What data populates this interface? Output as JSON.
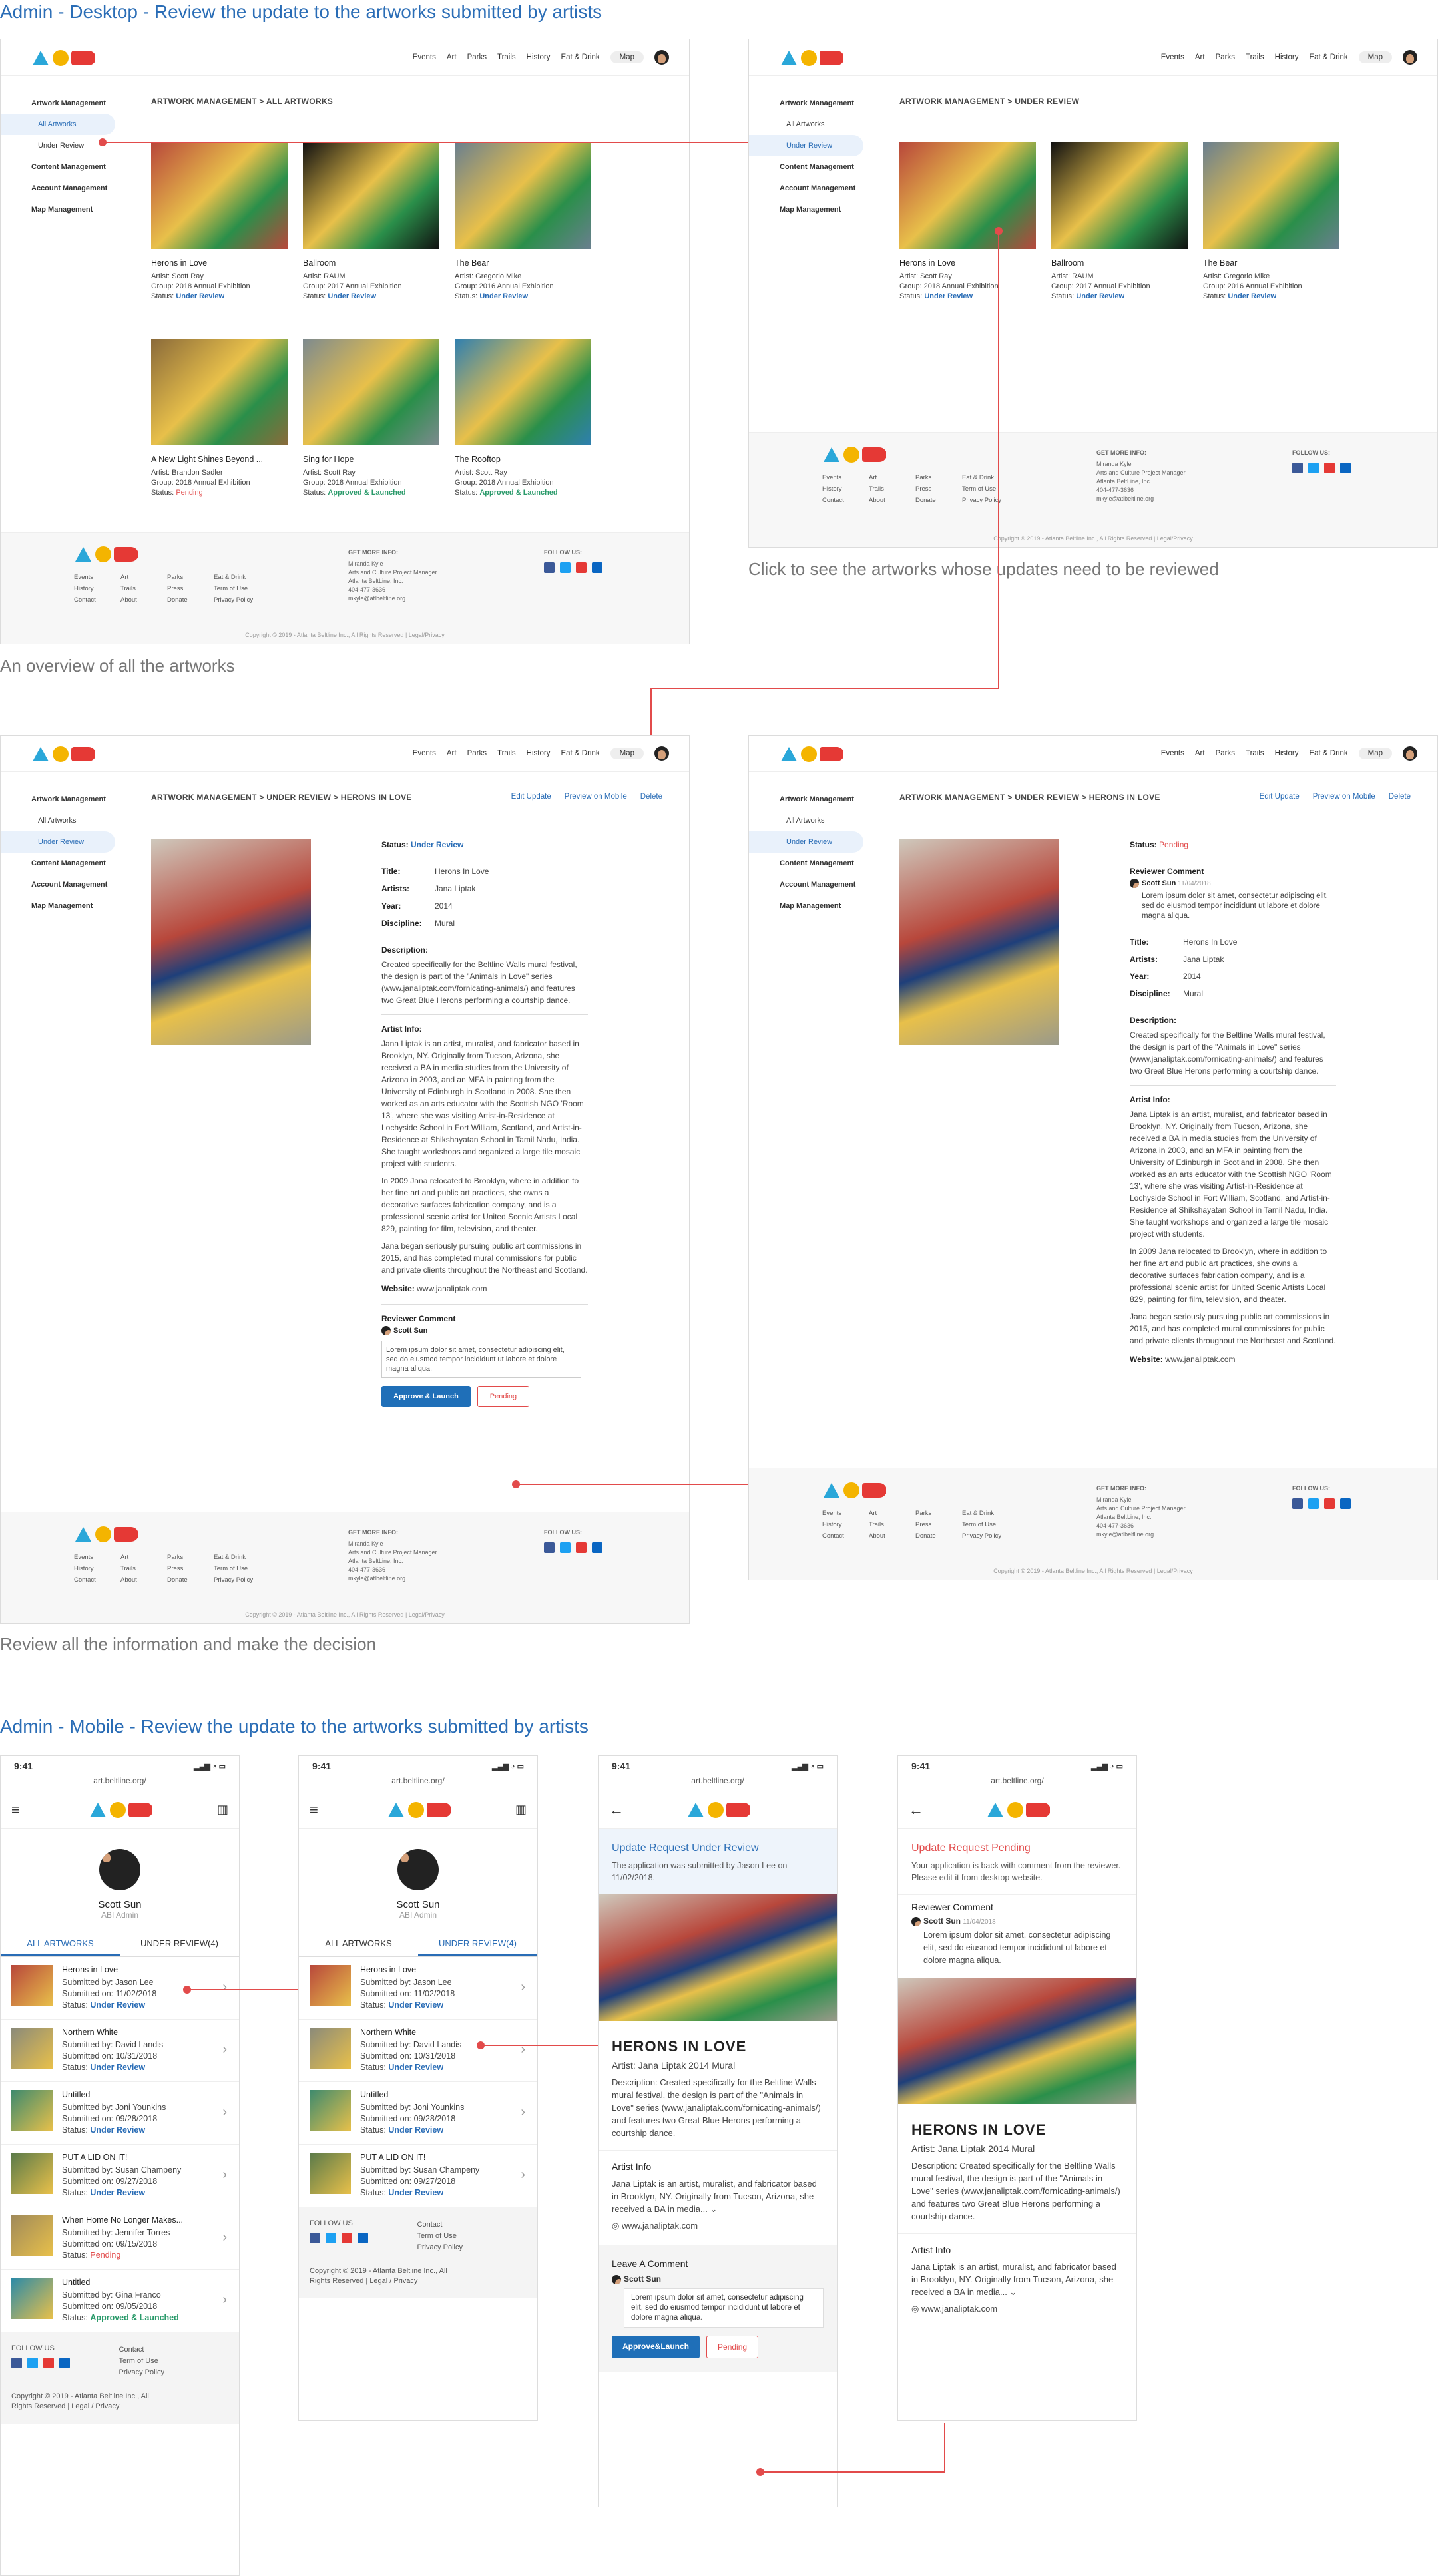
{
  "section1_title": "Admin - Desktop - Review the update to the artworks submitted by artists",
  "section2_title": "Admin - Mobile - Review the update to the artworks submitted by artists",
  "captions": {
    "overview": "An overview of all the artworks",
    "click": "Click to see the artworks whose updates need to be reviewed",
    "review": "Review all the information and make the decision"
  },
  "nav": {
    "links": [
      "Events",
      "Art",
      "Parks",
      "Trails",
      "History",
      "Eat & Drink"
    ],
    "map": "Map"
  },
  "sidebar": {
    "artwork_mgmt": "Artwork Management",
    "all": "All Artworks",
    "under_review": "Under Review",
    "content": "Content Management",
    "account": "Account Management",
    "map": "Map Management"
  },
  "crumbs": {
    "all": "ARTWORK MANAGEMENT  >  ALL ARTWORKS",
    "review": "ARTWORK MANAGEMENT  >  UNDER REVIEW",
    "detail": "ARTWORK MANAGEMENT  >  UNDER REVIEW  >  HERONS IN LOVE"
  },
  "actions": {
    "edit": "Edit Update",
    "preview": "Preview on Mobile",
    "delete": "Delete"
  },
  "artworks": [
    {
      "title": "Herons in Love",
      "artist": "Artist: Scott Ray",
      "group": "Group: 2018 Annual Exhibition",
      "status_label": "Status:",
      "status": "Under Review",
      "color": "#b8473b"
    },
    {
      "title": "Ballroom",
      "artist": "Artist: RAUM",
      "group": "Group: 2017 Annual Exhibition",
      "status_label": "Status:",
      "status": "Under Review",
      "color": "#111111"
    },
    {
      "title": "The Bear",
      "artist": "Artist: Gregorio Mike",
      "group": "Group: 2016 Annual Exhibition",
      "status_label": "Status:",
      "status": "Under Review",
      "color": "#6a7f8f"
    },
    {
      "title": "A New Light Shines Beyond ...",
      "artist": "Artist: Brandon Sadler",
      "group": "Group: 2018 Annual Exhibition",
      "status_label": "Status:",
      "status": "Pending",
      "color": "#8a6a3a"
    },
    {
      "title": "Sing for Hope",
      "artist": "Artist: Scott Ray",
      "group": "Group: 2018 Annual Exhibition",
      "status_label": "Status:",
      "status": "Approved & Launched",
      "color": "#7d8a8f"
    },
    {
      "title": "The Rooftop",
      "artist": "Artist: Scott Ray",
      "group": "Group: 2018 Annual Exhibition",
      "status_label": "Status:",
      "status": "Approved & Launched",
      "color": "#2f7fb0"
    }
  ],
  "footer": {
    "cols": [
      "Events",
      "Art",
      "Parks",
      "Eat & Drink",
      "History",
      "Trails",
      "Press",
      "Term of Use",
      "Contact",
      "About",
      "Donate",
      "Privacy Policy"
    ],
    "get_more": "GET MORE INFO:",
    "contact": [
      "Miranda Kyle",
      "Arts and Culture Project Manager",
      "Atlanta BeltLine, Inc.",
      "404-477-3636",
      "mkyle@atlbeltline.org"
    ],
    "follow": "FOLLOW US:",
    "copy": "Copyright © 2019 - Atlanta Beltline Inc., All Rights Reserved | Legal/Privacy"
  },
  "detail": {
    "status_label": "Status:",
    "status": "Under Review",
    "status_pending": "Pending",
    "title_label": "Title:",
    "title": "Herons In Love",
    "artists_label": "Artists:",
    "artists": "Jana Liptak",
    "year_label": "Year:",
    "year": "2014",
    "disc_label": "Discipline:",
    "discipline": "Mural",
    "desc_label": "Description:",
    "desc": "Created specifically for the Beltline Walls mural festival, the design is part of the \"Animals in Love\" series (www.janaliptak.com/fornicating-animals/) and features two Great Blue Herons performing a courtship dance.",
    "artist_info_label": "Artist Info:",
    "artist_info1": "Jana Liptak is an artist, muralist, and fabricator based in Brooklyn, NY. Originally from Tucson, Arizona, she received a BA in media studies from the University of Arizona in 2003, and an MFA in painting from the University of Edinburgh in Scotland in 2008. She then worked as an arts educator with the Scottish NGO 'Room 13', where she was visiting Artist-in-Residence at Lochyside School in Fort William, Scotland, and Artist-in-Residence at Shikshayatan School in Tamil Nadu, India. She taught workshops and organized a large tile mosaic project with students.",
    "artist_info2": "In 2009 Jana relocated to Brooklyn, where in addition to her fine art and public art practices, she owns a decorative surfaces fabrication company, and is a professional scenic artist for United Scenic Artists Local 829, painting for film, television, and theater.",
    "artist_info3": "Jana began seriously pursuing public art commissions in 2015, and has completed mural commissions for public and private clients throughout the Northeast and Scotland.",
    "website_label": "Website:",
    "website": "www.janaliptak.com",
    "reviewer_label": "Reviewer Comment",
    "reviewer": "Scott Sun",
    "review_date": "11/04/2018",
    "comment": "Lorem ipsum dolor sit amet, consectetur adipiscing elit, sed do eiusmod tempor incididunt ut labore et dolore magna aliqua.",
    "approve": "Approve & Launch",
    "pending": "Pending"
  },
  "mobile": {
    "time": "9:41",
    "url": "art.beltline.org/",
    "user": "Scott Sun",
    "role": "ABI Admin",
    "tab_all": "ALL ARTWORKS",
    "tab_review": "UNDER REVIEW(4)",
    "items": [
      {
        "title": "Herons in Love",
        "by": "Submitted by: Jason Lee",
        "on": "Submitted on: 11/02/2018",
        "status": "Under Review",
        "color": "#b8473b"
      },
      {
        "title": "Northern White",
        "by": "Submitted by: David Landis",
        "on": "Submitted on: 10/31/2018",
        "status": "Under Review",
        "color": "#8a8a7a"
      },
      {
        "title": "Untitled",
        "by": "Submitted by: Joni Younkins",
        "on": "Submitted on: 09/28/2018",
        "status": "Under Review",
        "color": "#3d8a6e"
      },
      {
        "title": "PUT A LID ON IT!",
        "by": "Submitted by: Susan Champeny",
        "on": "Submitted on: 09/27/2018",
        "status": "Under Review",
        "color": "#5a7a4a"
      },
      {
        "title": "When Home No Longer Makes...",
        "by": "Submitted by: Jennifer Torres",
        "on": "Submitted on: 09/15/2018",
        "status": "Pending",
        "color": "#a08a5a"
      },
      {
        "title": "Untitled",
        "by": "Submitted by: Gina Franco",
        "on": "Submitted on: 09/05/2018",
        "status": "Approved & Launched",
        "color": "#2a8aa8"
      }
    ],
    "status_label": "Status:",
    "follow": "FOLLOW US",
    "links": [
      "Contact",
      "Term of Use",
      "Privacy Policy"
    ],
    "copy": "Copyright © 2019 - Atlanta Beltline Inc., All Rights Reserved | Legal / Privacy",
    "update_title": "Update Request Under Review",
    "update_text": "The application was submitted by Jason Lee on 11/02/2018.",
    "pending_title": "Update Request Pending",
    "pending_text": "Your application is back with comment from the reviewer. Please edit it from desktop website.",
    "reviewer": "Reviewer Comment",
    "reviewer_name": "Scott Sun",
    "reviewer_date": "11/04/2018",
    "comment": "Lorem ipsum dolor sit amet, consectetur adipiscing elit, sed do eiusmod tempor incididunt ut labore et dolore magna aliqua.",
    "art_title": "HERONS IN LOVE",
    "art_meta": "Artist: Jana Liptak      2014      Mural",
    "art_desc": "Description: Created specifically for the Beltline Walls mural festival, the design is part of the \"Animals in Love\" series (www.janaliptak.com/fornicating-animals/) and features two Great Blue Herons performing a courtship dance.",
    "artist_info": "Artist Info",
    "artist_text": "Jana Liptak is an artist, muralist, and fabricator based in Brooklyn, NY. Originally from Tucson, Arizona, she received a BA in media... ⌄",
    "website": "www.janaliptak.com",
    "leave_comment": "Leave A Comment",
    "approve": "Approve&Launch",
    "pending": "Pending"
  }
}
